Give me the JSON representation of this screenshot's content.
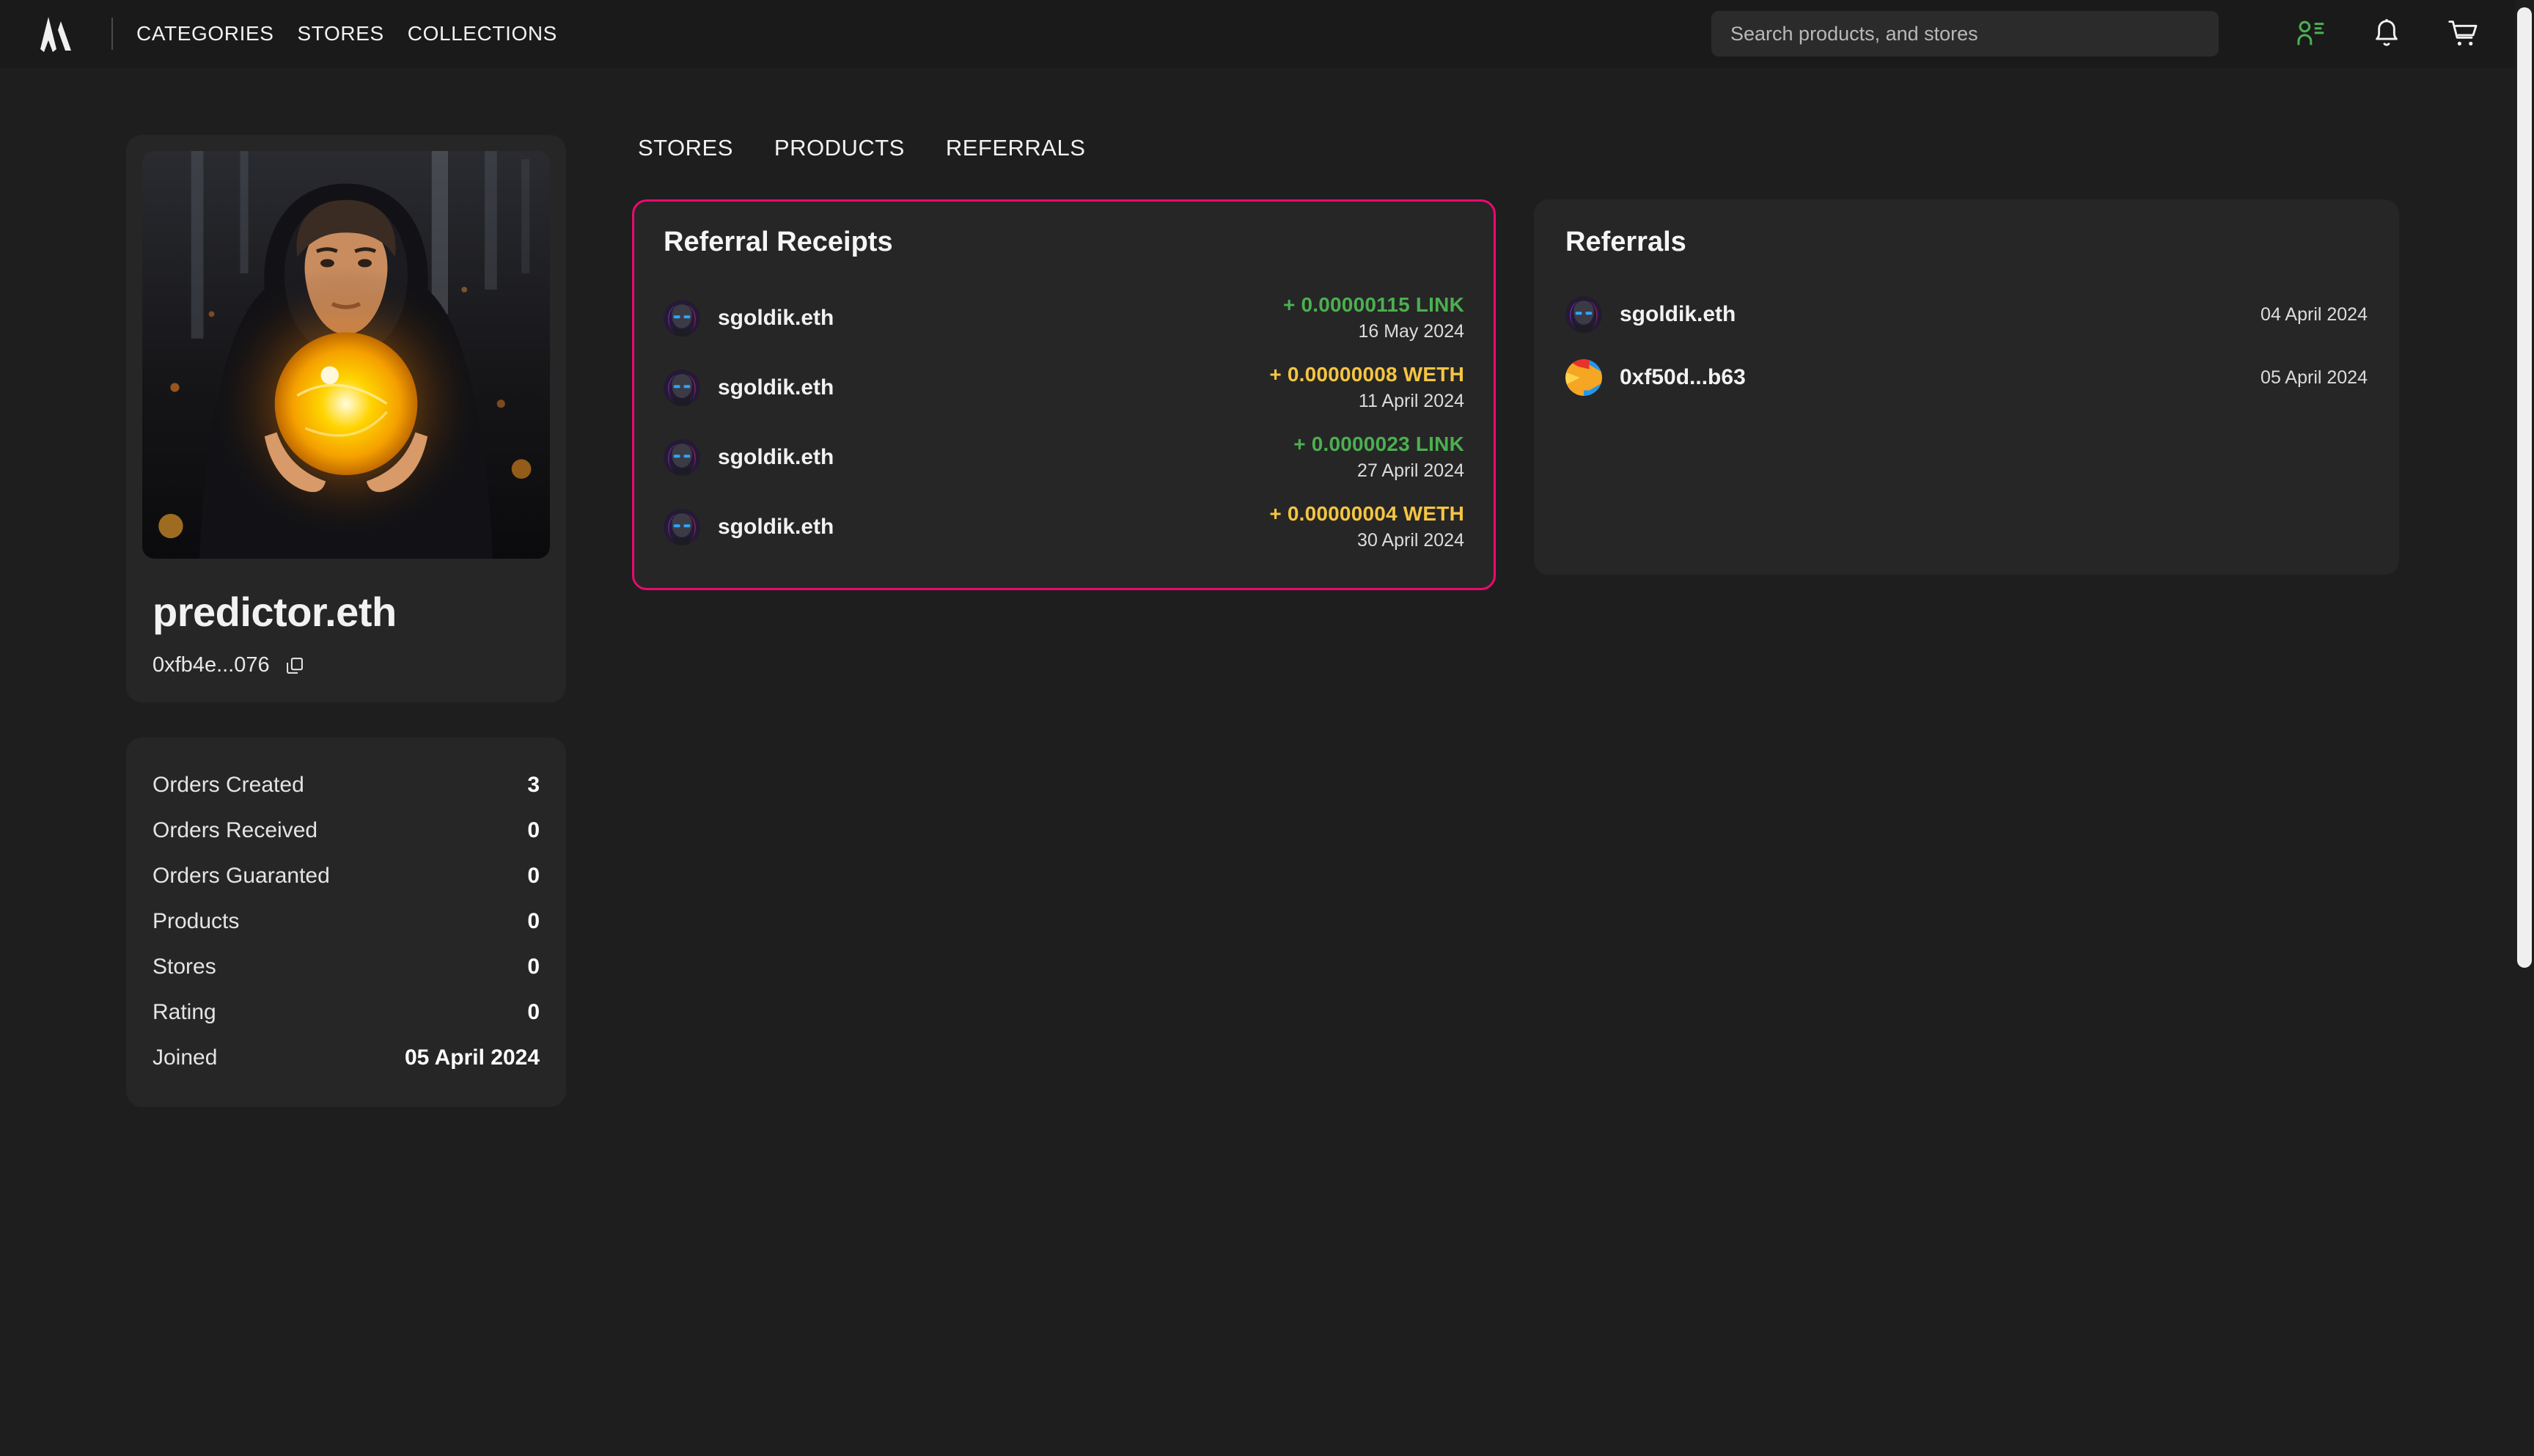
{
  "header": {
    "logo_name": "mercata-logo",
    "nav": [
      {
        "label": "CATEGORIES"
      },
      {
        "label": "STORES"
      },
      {
        "label": "COLLECTIONS"
      }
    ],
    "search": {
      "placeholder": "Search products, and stores",
      "value": ""
    },
    "icons": [
      {
        "name": "account-list-icon",
        "color": "#4caf50"
      },
      {
        "name": "bell-icon",
        "color": "#f2f2f2"
      },
      {
        "name": "cart-icon",
        "color": "#f2f2f2"
      }
    ]
  },
  "profile": {
    "avatar_alt": "hooded-figure-holding-glowing-orb",
    "name": "predictor.eth",
    "address": "0xfb4e...076",
    "copy_icon": "copy-icon"
  },
  "stats": [
    {
      "label": "Orders Created",
      "value": "3"
    },
    {
      "label": "Orders Received",
      "value": "0"
    },
    {
      "label": "Orders Guaranted",
      "value": "0"
    },
    {
      "label": "Products",
      "value": "0"
    },
    {
      "label": "Stores",
      "value": "0"
    },
    {
      "label": "Rating",
      "value": "0"
    },
    {
      "label": "Joined",
      "value": "05 April 2024"
    }
  ],
  "tabs": [
    {
      "label": "STORES"
    },
    {
      "label": "PRODUCTS"
    },
    {
      "label": "REFERRALS"
    }
  ],
  "receipts_panel": {
    "title": "Referral Receipts",
    "border_color": "#ea0a70",
    "rows": [
      {
        "name": "sgoldik.eth",
        "amount": "+ 0.00000115 LINK",
        "token": "LINK",
        "date": "16 May 2024"
      },
      {
        "name": "sgoldik.eth",
        "amount": "+ 0.00000008 WETH",
        "token": "WETH",
        "date": "11 April 2024"
      },
      {
        "name": "sgoldik.eth",
        "amount": "+ 0.0000023 LINK",
        "token": "LINK",
        "date": "27 April 2024"
      },
      {
        "name": "sgoldik.eth",
        "amount": "+ 0.00000004 WETH",
        "token": "WETH",
        "date": "30 April 2024"
      }
    ]
  },
  "referrals_panel": {
    "title": "Referrals",
    "rows": [
      {
        "name": "sgoldik.eth",
        "date": "04 April 2024",
        "avatar": "dark-figure-avatar"
      },
      {
        "name": "0xf50d...b63",
        "date": "05 April 2024",
        "avatar": "blockie-avatar"
      }
    ]
  },
  "colors": {
    "page_bg": "#1e1e1e",
    "card_bg": "#262626",
    "header_bg": "#1a1a1a",
    "accent_pink": "#ea0a70",
    "link_green": "#4caf50",
    "weth_yellow": "#f5c542",
    "account_green": "#4caf50"
  }
}
